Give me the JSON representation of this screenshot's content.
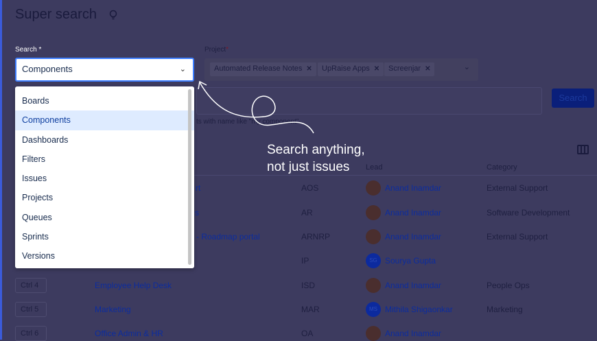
{
  "header": {
    "title": "Super search",
    "icon": "lightbulb-icon"
  },
  "search": {
    "label": "Search",
    "required": "*",
    "value": "Components",
    "options": [
      "Boards",
      "Components",
      "Dashboards",
      "Filters",
      "Issues",
      "Projects",
      "Queues",
      "Sprints",
      "Versions"
    ],
    "selected_index": 1
  },
  "project": {
    "label": "Project",
    "required": "*",
    "chips": [
      "Automated Release Notes",
      "UpRaise Apps",
      "Screenjar"
    ]
  },
  "query": {
    "helper": "ts with name like \"my component\"",
    "button": "Search"
  },
  "annotation": {
    "line1": "Search anything,",
    "line2": "not just issues"
  },
  "table": {
    "headers": {
      "lead": "Lead",
      "category": "Category"
    },
    "rows": [
      {
        "ctrl": "",
        "name": "rt",
        "key": "AOS",
        "lead": "Anand Inamdar",
        "initials": "",
        "category": "External Support"
      },
      {
        "ctrl": "",
        "name": "s",
        "key": "AR",
        "lead": "Anand Inamdar",
        "initials": "",
        "category": "Software Development"
      },
      {
        "ctrl": "",
        "name": "- Roadmap portal",
        "key": "ARNRP",
        "lead": "Anand Inamdar",
        "initials": "",
        "category": "External Support"
      },
      {
        "ctrl": "",
        "name": "",
        "key": "IP",
        "lead": "Sourya Gupta",
        "initials": "SG",
        "category": ""
      },
      {
        "ctrl": "Ctrl 4",
        "name": "Employee Help Desk",
        "key": "ISD",
        "lead": "Anand Inamdar",
        "initials": "",
        "category": "People Ops"
      },
      {
        "ctrl": "Ctrl 5",
        "name": "Marketing",
        "key": "MAR",
        "lead": "Mithila Shigaonkar",
        "initials": "MS",
        "category": "Marketing"
      },
      {
        "ctrl": "Ctrl 6",
        "name": "Office Admin & HR",
        "key": "OA",
        "lead": "Anand Inamdar",
        "initials": "",
        "category": ""
      }
    ]
  },
  "colors": {
    "accent": "#3d7eff",
    "overlay": "#3d3b5f",
    "selected": "#deebff"
  }
}
